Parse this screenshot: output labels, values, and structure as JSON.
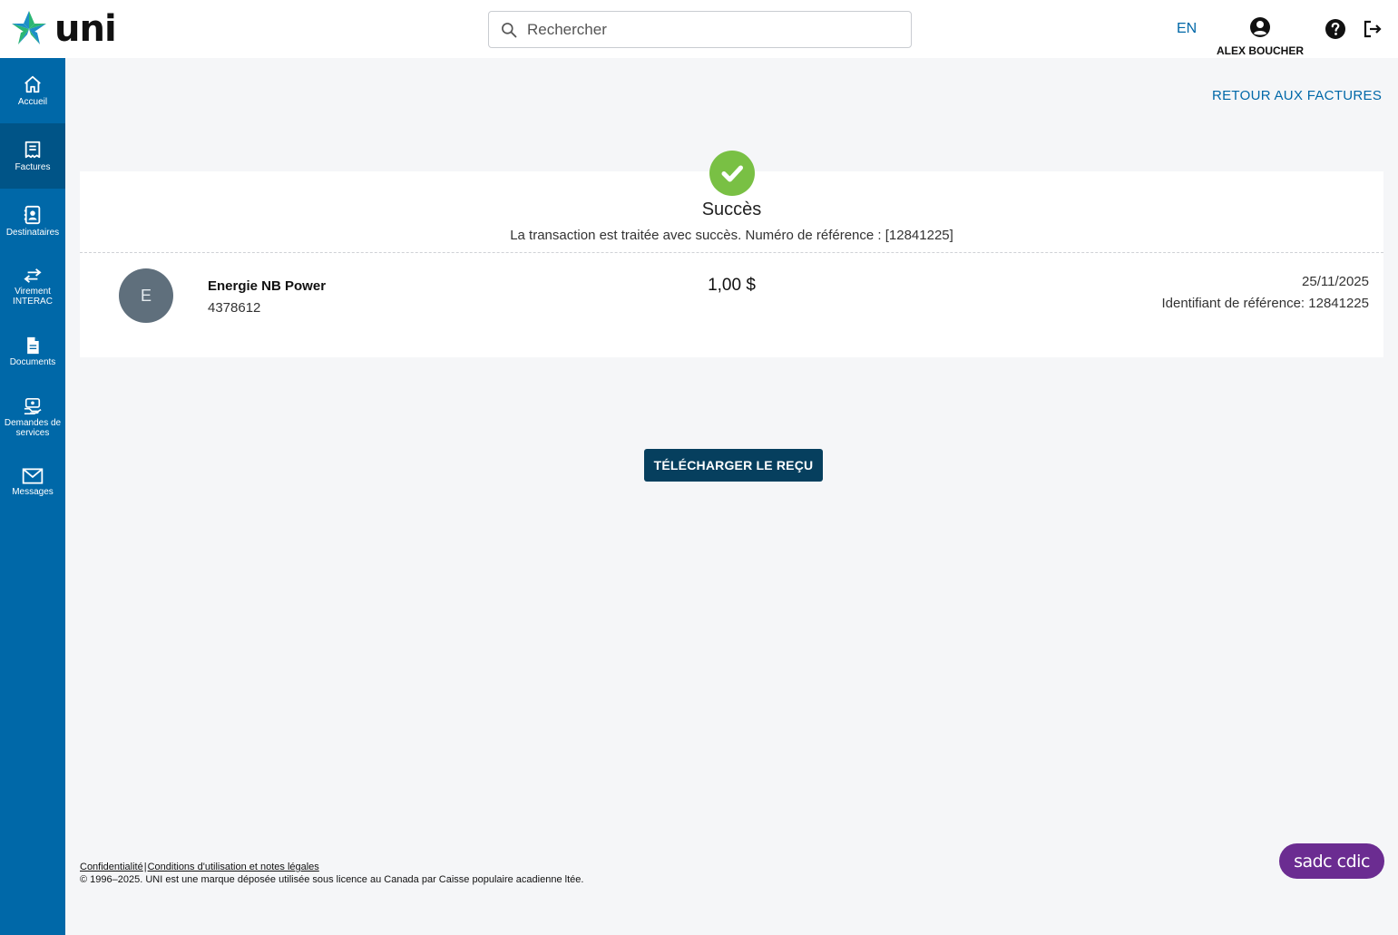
{
  "header": {
    "logo_text": "uni",
    "search_placeholder": "Rechercher",
    "language_toggle": "EN",
    "user_name": "ALEX BOUCHER"
  },
  "sidebar": {
    "items": [
      {
        "label": "Accueil",
        "icon": "home-icon"
      },
      {
        "label": "Factures",
        "icon": "receipt-icon",
        "active": true
      },
      {
        "label": "Destinataires",
        "icon": "contacts-icon"
      },
      {
        "label": "Virement INTERAC",
        "icon": "transfer-icon"
      },
      {
        "label": "Documents",
        "icon": "document-icon"
      },
      {
        "label": "Demandes de services",
        "icon": "service-request-icon"
      },
      {
        "label": "Messages",
        "icon": "mail-icon"
      }
    ]
  },
  "main": {
    "back_link": "RETOUR AUX FACTURES",
    "confirmation": {
      "title": "Succès",
      "message": "La transaction est traitée avec succès. Numéro de référence : [12841225]",
      "payee_initial": "E",
      "payee_name": "Energie NB Power",
      "payee_account": "4378612",
      "amount": "1,00 $",
      "date": "25/11/2025",
      "reference": "Identifiant de référence: 12841225"
    },
    "download_button": "TÉLÉCHARGER LE REÇU"
  },
  "footer": {
    "privacy_link": "Confidentialité",
    "separator": "|",
    "terms_link": "Conditions d'utilisation et notes légales",
    "copyright": "© 1996–2025. UNI est une marque déposée utilisée sous licence au Canada par Caisse populaire acadienne ltée.",
    "cdic_badge": "sadc cdic"
  },
  "colors": {
    "sidebar": "#0068a8",
    "sidebar_active": "#005487",
    "success": "#79c044",
    "button": "#063f5e",
    "link": "#0068a8",
    "cdic": "#6b2c91"
  }
}
